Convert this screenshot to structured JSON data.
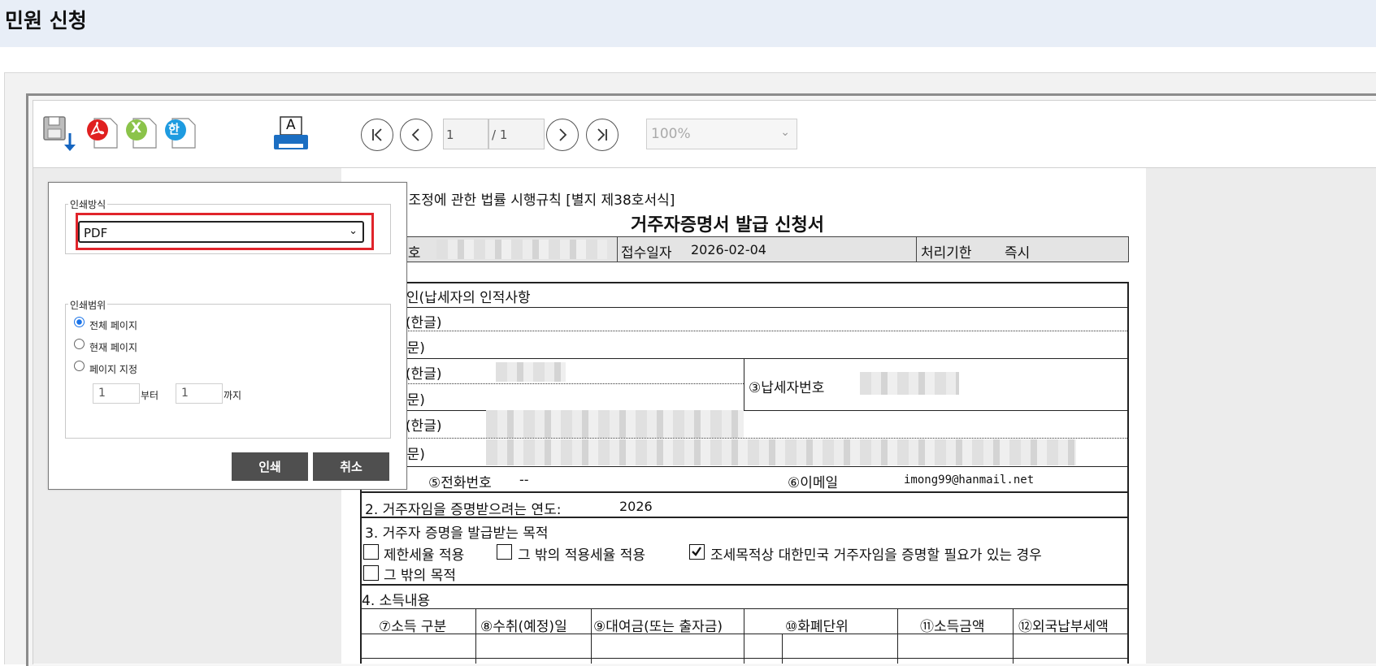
{
  "header": {
    "title": "민원 신청"
  },
  "toolbar": {
    "icons": [
      "save-icon",
      "pdf-icon",
      "excel-icon",
      "hwp-icon",
      "print-icon"
    ],
    "hwp_glyph": "한",
    "excel_glyph": "X",
    "print_glyph": "A",
    "page_current": "1",
    "page_total": "/ 1",
    "zoom": "100%"
  },
  "document": {
    "law_ref": "국제조세조정에 관한 법률 시행규칙 [별지 제38호서식]",
    "title": "거주자증명서 발급 신청서",
    "receipt_no_label": "접수번호",
    "receipt_date_label": "접수일자",
    "receipt_date": "2026-02-04",
    "deadline_label": "처리기한",
    "deadline": "즉시",
    "section1": "1. 신청인(납세자의 인적사항",
    "name_ko": "① 상호(한글)",
    "name_en": "상호(영문)",
    "rep_ko": "② 성명(한글)",
    "rep_en": "성명(영문)",
    "taxpayer_no_label": "③납세자번호",
    "addr_ko": "④ 주소(한글)",
    "addr_en": "주소(영문)",
    "phone_label": "⑤전화번호",
    "phone": "--",
    "email_label": "⑥이메일",
    "email": "imong99@hanmail.net",
    "section2": "2. 거주자임을 증명받으려는 연도:",
    "year": "2026",
    "section3": "3. 거주자 증명을 발급받는 목적",
    "purpose1": "제한세율 적용",
    "purpose2": "그 밖의 적용세율 적용",
    "purpose3": "조세목적상 대한민국 거주자임을 증명할 필요가 있는 경우",
    "purpose4": "그 밖의 목적",
    "purpose_checked": [
      false,
      false,
      true,
      false
    ],
    "section4": "4. 소득내용",
    "columns": [
      "⑦소득 구분",
      "⑧수취(예정)일",
      "⑨대여금(또는 출자금)",
      "⑩화폐단위",
      "⑪소득금액",
      "⑫외국납부세액"
    ]
  },
  "dialog": {
    "method_legend": "인쇄방식",
    "method_value": "PDF",
    "range_legend": "인쇄범위",
    "range_options": [
      "전체 페이지",
      "현재 페이지",
      "페이지 지정"
    ],
    "range_selected": 0,
    "from_value": "1",
    "from_suffix": "부터",
    "to_value": "1",
    "to_suffix": "까지",
    "print_button": "인쇄",
    "cancel_button": "취소"
  },
  "colors": {
    "highlight": "#e0242b",
    "header_bg": "#e8eef7",
    "button_bg": "#4f4f4f",
    "radio_accent": "#1a73e8"
  }
}
